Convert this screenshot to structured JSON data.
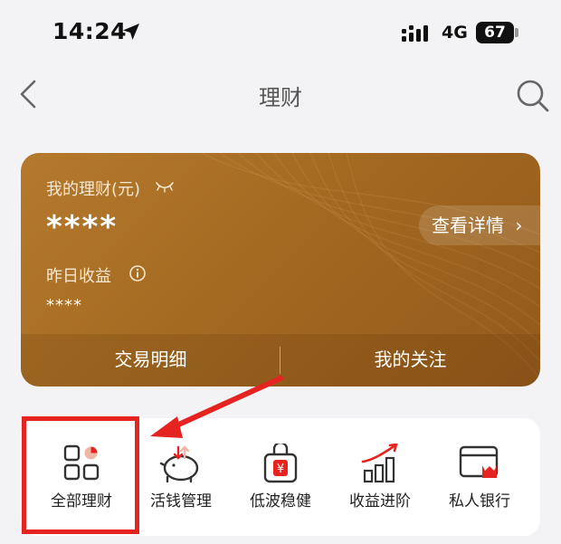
{
  "status_bar": {
    "time": "14:24",
    "network": "4G",
    "battery": "67"
  },
  "nav": {
    "title": "理财"
  },
  "card": {
    "label": "我的理财(元)",
    "amount": "****",
    "detail_button": "查看详情",
    "detail_chevron": "›",
    "yesterday_label": "昨日收益",
    "yesterday_value": "****",
    "tabs": [
      "交易明细",
      "我的关注"
    ]
  },
  "menu": {
    "items": [
      {
        "label": "全部理财",
        "icon": "grid-icon"
      },
      {
        "label": "活钱管理",
        "icon": "piggy-bank-icon"
      },
      {
        "label": "低波稳健",
        "icon": "bag-icon"
      },
      {
        "label": "收益进阶",
        "icon": "growth-chart-icon"
      },
      {
        "label": "私人银行",
        "icon": "crown-card-icon"
      }
    ]
  },
  "colors": {
    "accent": "#e52421",
    "card_gold": "#a46a22",
    "highlight": "#e52421"
  }
}
